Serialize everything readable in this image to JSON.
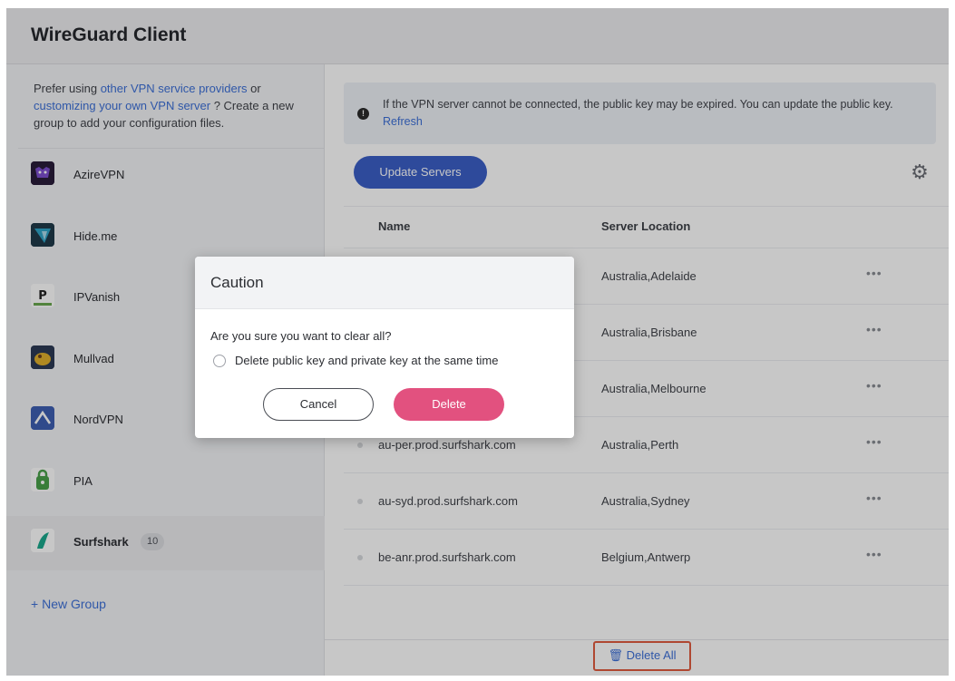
{
  "app": {
    "title": "WireGuard Client"
  },
  "sidebar": {
    "hint_prefix": "Prefer using ",
    "hint_link1": "other VPN service providers",
    "hint_mid": " or ",
    "hint_link2": "customizing your own VPN server",
    "hint_suffix": " ? Create a new group to add your configuration files.",
    "items": [
      {
        "name": "AzireVPN",
        "icon": "azirevpn-logo-icon",
        "color": "#2a1d3a"
      },
      {
        "name": "Hide.me",
        "icon": "hideme-logo-icon",
        "color": "#1f3a4a"
      },
      {
        "name": "IPVanish",
        "icon": "ipvanish-logo-icon",
        "color": "#ffffff"
      },
      {
        "name": "Mullvad",
        "icon": "mullvad-logo-icon",
        "color": "#2c3a55"
      },
      {
        "name": "NordVPN",
        "icon": "nordvpn-logo-icon",
        "color": "#3e5fb2"
      },
      {
        "name": "PIA",
        "icon": "pia-logo-icon",
        "color": "#ffffff"
      },
      {
        "name": "Surfshark",
        "icon": "surfshark-logo-icon",
        "color": "#ffffff",
        "badge": "10",
        "active": true
      }
    ],
    "new_group": "New Group"
  },
  "main": {
    "notice_text": "If the VPN server cannot be connected, the public key may be expired. You can update the public key.",
    "notice_link": "Refresh",
    "update_button": "Update Servers",
    "columns": {
      "name": "Name",
      "location": "Server Location"
    },
    "rows": [
      {
        "host": "",
        "location": "Australia,Adelaide"
      },
      {
        "host": "",
        "location": "Australia,Brisbane"
      },
      {
        "host": "",
        "location": "Australia,Melbourne"
      },
      {
        "host": "au-per.prod.surfshark.com",
        "location": "Australia,Perth"
      },
      {
        "host": "au-syd.prod.surfshark.com",
        "location": "Australia,Sydney"
      },
      {
        "host": "be-anr.prod.surfshark.com",
        "location": "Belgium,Antwerp"
      }
    ],
    "more_label": "•••",
    "delete_all": "Delete All"
  },
  "dialog": {
    "title": "Caution",
    "question": "Are you sure you want to clear all?",
    "checkbox_label": "Delete public key and private key at the same time",
    "cancel": "Cancel",
    "delete": "Delete"
  },
  "colors": {
    "accent_blue": "#3b5fc7",
    "link_blue": "#3d70d8",
    "delete_pink": "#e2517f",
    "highlight_red": "#e15b3f"
  }
}
